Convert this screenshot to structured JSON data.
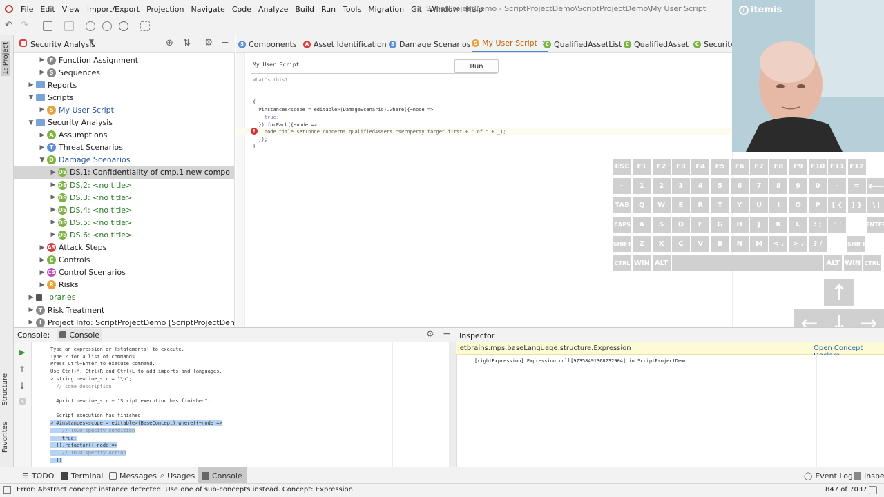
{
  "window_title": "ScriptProjectDemo - ScriptProjectDemo\\ScriptProjectDemo\\My User Script",
  "menu": [
    "File",
    "Edit",
    "View",
    "Import/Export",
    "Projection",
    "Navigate",
    "Code",
    "Analyze",
    "Build",
    "Run",
    "Tools",
    "Migration",
    "Git",
    "Window",
    "Help"
  ],
  "project_panel": {
    "title": "Security Analysis",
    "tree": [
      {
        "label": "Function Assignment",
        "icon": "function-icon",
        "icon_letter": "F",
        "color": "#888"
      },
      {
        "label": "Sequences",
        "icon": "sequence-icon",
        "icon_letter": "S",
        "color": "#888"
      },
      {
        "label": "Reports",
        "icon": "folder-icon"
      },
      {
        "label": "Scripts",
        "icon": "folder-icon"
      },
      {
        "label": "My User Script",
        "icon": "script-icon",
        "icon_letter": "S",
        "color": "#e8a33c"
      },
      {
        "label": "Security Analysis",
        "icon": "folder-icon"
      },
      {
        "label": "Assumptions",
        "icon": "assumption-icon",
        "icon_letter": "A",
        "color": "#7cb342"
      },
      {
        "label": "Threat Scenarios",
        "icon": "threat-icon",
        "icon_letter": "T",
        "color": "#5b8fd6"
      },
      {
        "label": "Damage Scenarios",
        "icon": "damage-icon",
        "icon_letter": "D",
        "color": "#7cb342"
      },
      {
        "label": "DS.1: Confidentiality of cmp.1 new compo",
        "icon": "ds-icon",
        "icon_letter": "DS",
        "color": "#7cb342"
      },
      {
        "label": "DS.2: <no title>",
        "icon": "ds-icon",
        "icon_letter": "DS",
        "color": "#7cb342"
      },
      {
        "label": "DS.3: <no title>",
        "icon": "ds-icon",
        "icon_letter": "DS",
        "color": "#7cb342"
      },
      {
        "label": "DS.4: <no title>",
        "icon": "ds-icon",
        "icon_letter": "DS",
        "color": "#7cb342"
      },
      {
        "label": "DS.5: <no title>",
        "icon": "ds-icon",
        "icon_letter": "DS",
        "color": "#7cb342"
      },
      {
        "label": "DS.6: <no title>",
        "icon": "ds-icon",
        "icon_letter": "DS",
        "color": "#7cb342"
      },
      {
        "label": "Attack Steps",
        "icon": "attack-icon",
        "icon_letter": "AS",
        "color": "#d84040"
      },
      {
        "label": "Controls",
        "icon": "controls-icon",
        "icon_letter": "C",
        "color": "#7cb342"
      },
      {
        "label": "Control Scenarios",
        "icon": "control-scenario-icon",
        "icon_letter": "CS",
        "color": "#c04ec0"
      },
      {
        "label": "Risks",
        "icon": "risk-icon",
        "icon_letter": "R",
        "color": "#e8a33c"
      },
      {
        "label": "libraries",
        "icon": "libraries-icon"
      },
      {
        "label": "Risk Treatment",
        "icon": "risk-treatment-icon",
        "icon_letter": "T",
        "color": "#888"
      },
      {
        "label": "Project Info: ScriptProjectDemo [ScriptProjectDemo]",
        "icon": "info-icon",
        "icon_letter": "I",
        "color": "#888"
      }
    ]
  },
  "editor_tabs": [
    {
      "label": "Components",
      "icon_letter": "S",
      "color": "#5b8fd6"
    },
    {
      "label": "Asset Identification",
      "icon_letter": "A",
      "color": "#d84040"
    },
    {
      "label": "Damage Scenarios",
      "icon_letter": "S",
      "color": "#5b8fd6"
    },
    {
      "label": "My User Script",
      "icon_letter": "S",
      "color": "#e8a33c"
    },
    {
      "label": "QualifiedAssetList",
      "icon_letter": "C",
      "color": "#7cb342"
    },
    {
      "label": "QualifiedAsset",
      "icon_letter": "C",
      "color": "#7cb342"
    },
    {
      "label": "SecurityG",
      "icon_letter": "C",
      "color": "#7cb342"
    }
  ],
  "editor": {
    "header": "My User Script",
    "run_label": "Run",
    "whats_this": "What's this?",
    "lines": [
      "{",
      "  #instances<scope = editable>(DamageScenario).where({~node =>",
      "    true;",
      "  }).forEach({~node =>",
      "    node.title.set(node.concerns.qualifiedAssets.csProperty.target.first + \" of \" + _);",
      "  });",
      "}"
    ]
  },
  "logo": "itemis",
  "keyboard": {
    "rows": [
      [
        "ESC",
        "F1",
        "F2",
        "F3",
        "F4",
        "F5",
        "F6",
        "F7",
        "F8",
        "F9",
        "F10",
        "F11",
        "F12"
      ],
      [
        "~",
        "1",
        "2",
        "3",
        "4",
        "5",
        "6",
        "7",
        "8",
        "9",
        "0",
        "-",
        "=",
        "⟵"
      ],
      [
        "TAB",
        "Q",
        "W",
        "E",
        "R",
        "T",
        "Y",
        "U",
        "I",
        "O",
        "P",
        "[ {",
        "] }",
        "\\ |"
      ],
      [
        "CAPS",
        "A",
        "S",
        "D",
        "F",
        "G",
        "H",
        "J",
        "K",
        "L",
        ": ;",
        "\" '",
        "ENTER"
      ],
      [
        "SHIFT",
        "Z",
        "X",
        "C",
        "V",
        "B",
        "N",
        "M",
        "< ,",
        "> .",
        "? /",
        "SHIFT"
      ],
      [
        "CTRL",
        "WIN",
        "ALT",
        "",
        "ALT",
        "WIN",
        "CTRL"
      ]
    ]
  },
  "console": {
    "title_label": "Console:",
    "tab_label": "Console",
    "lines": [
      "Type an expression or {statements} to execute.",
      "Type ? for a list of commands.",
      "Press Ctrl+Enter to execute command.",
      "Use Ctrl+M, Ctrl+R and Ctrl+L to add imports and languages.",
      "> string newLine_str = \"\\n\";",
      "  // some description",
      "",
      "  #print newLine_str + \"Script execution has finished\";",
      "",
      "  Script execution has finished"
    ],
    "selected_lines": [
      "> #instances<scope = editable>(BaseConcept).where({~node =>",
      "    // TODO specify condition",
      "    true;",
      "  }).refactor({~node =>",
      "    // TODO specify action",
      "  })"
    ]
  },
  "inspector": {
    "title": "Inspector",
    "concept": "jetbrains.mps.baseLanguage.structure.Expression",
    "open_concept": "Open Concept Declara",
    "error_text": "[rightExpression] Expression null[9735849136823290​4] in ScriptProjectDemo"
  },
  "tool_windows": [
    "TODO",
    "Terminal",
    "Messages",
    "Usages",
    "Console"
  ],
  "tool_windows_right": [
    "Event Log",
    "Inspec"
  ],
  "left_strip": [
    "1: Project",
    "Structure",
    "Favorites"
  ],
  "status": {
    "message": "Error: Abstract concept instance detected. Use one of sub-concepts instead. Concept: Expression",
    "memory": "847 of 7037"
  },
  "colors": {
    "accent": "#4a86c8",
    "selection": "#b7d3f3",
    "error": "#d32f2f",
    "inspector_bg": "#fdfbd6"
  }
}
